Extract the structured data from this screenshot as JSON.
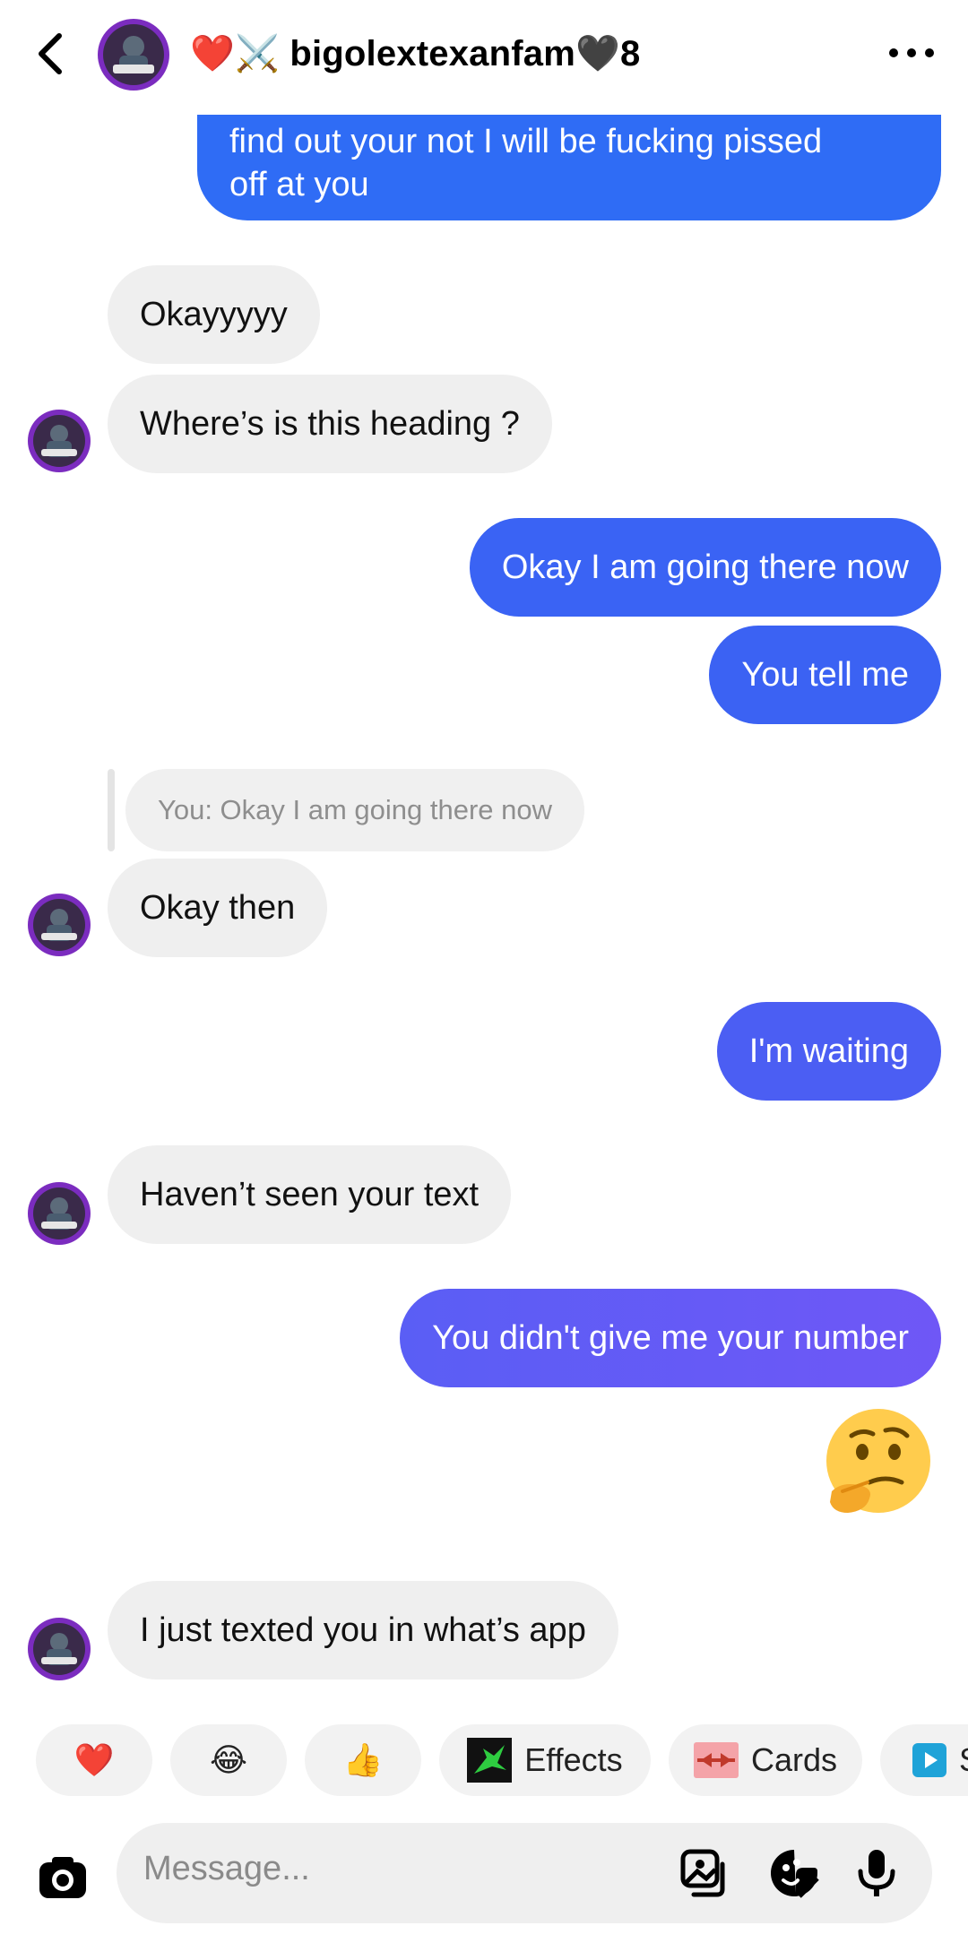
{
  "header": {
    "title": "❤️⚔️ bigolextexanfam🖤8",
    "back_icon": "chevron-left-icon",
    "more_icon": "more-horizontal-icon"
  },
  "messages": {
    "m0": "find out your not I will be fucking pissed",
    "m0b": "off at you",
    "m1": "Okayyyyy",
    "m2": "Where’s is this heading ?",
    "m3": "Okay I am going there now",
    "m4": "You tell me",
    "m5_reply": "You: Okay I am going there now",
    "m5": "Okay then",
    "m6": "I'm waiting",
    "m7": "Haven’t seen your text",
    "m8": "You didn't give me your number",
    "m9_emoji": "thinking-face",
    "m10": "I just texted you in what’s app"
  },
  "quick_actions": {
    "heart": "❤️",
    "laugh": "😂",
    "thumbs": "👍",
    "effects": "Effects",
    "cards": "Cards",
    "more": "S"
  },
  "composer": {
    "placeholder": "Message..."
  },
  "colors": {
    "tx_blue": "#3b62f2",
    "tx_violet": "#6357f6",
    "rx_gray": "#efefef"
  }
}
